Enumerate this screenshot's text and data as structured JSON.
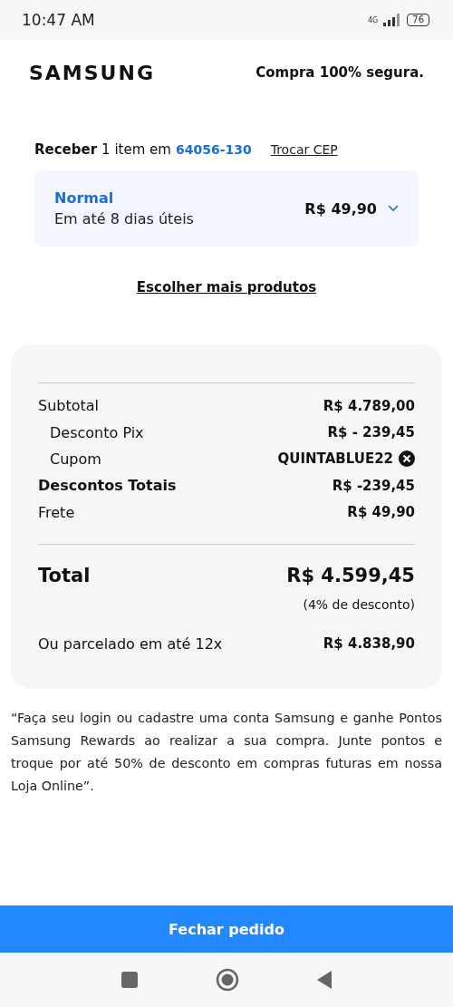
{
  "status_bar": {
    "time": "10:47 AM",
    "network": "4G",
    "battery": "76"
  },
  "header": {
    "logo": "SAMSUNG",
    "secure": "Compra 100% segura."
  },
  "delivery": {
    "receive_label": "Receber",
    "receive_text": "1 item em",
    "cep": "64056-130",
    "change_cep": "Trocar CEP",
    "option": {
      "name": "Normal",
      "eta": "Em até 8 dias úteis",
      "price": "R$ 49,90",
      "expanded": false
    },
    "more_products": "Escolher mais produtos"
  },
  "summary": {
    "rows": [
      {
        "kind": "plain",
        "label": "Subtotal",
        "value": "R$ 4.789,00"
      },
      {
        "kind": "sub",
        "label": "Desconto Pix",
        "value": "R$ - 239,45"
      },
      {
        "kind": "coupon",
        "label": "Cupom",
        "value": "QUINTABLUE22"
      },
      {
        "kind": "bold",
        "label": "Descontos Totais",
        "value": "R$ -239,45"
      },
      {
        "kind": "plain",
        "label": "Frete",
        "value": "R$ 49,90"
      }
    ],
    "total_label": "Total",
    "total_value": "R$ 4.599,45",
    "discount_note": "(4% de desconto)",
    "installments_label": "Ou parcelado em até 12x",
    "installments_value": "R$ 4.838,90"
  },
  "rewards_note": "“Faça seu login ou cadastre uma conta Samsung e ganhe Pontos Samsung Rewards ao realizar a sua compra. Junte pontos e troque por até 50% de desconto em compras futuras em nossa Loja Online”.",
  "checkout_button": "Fechar pedido"
}
